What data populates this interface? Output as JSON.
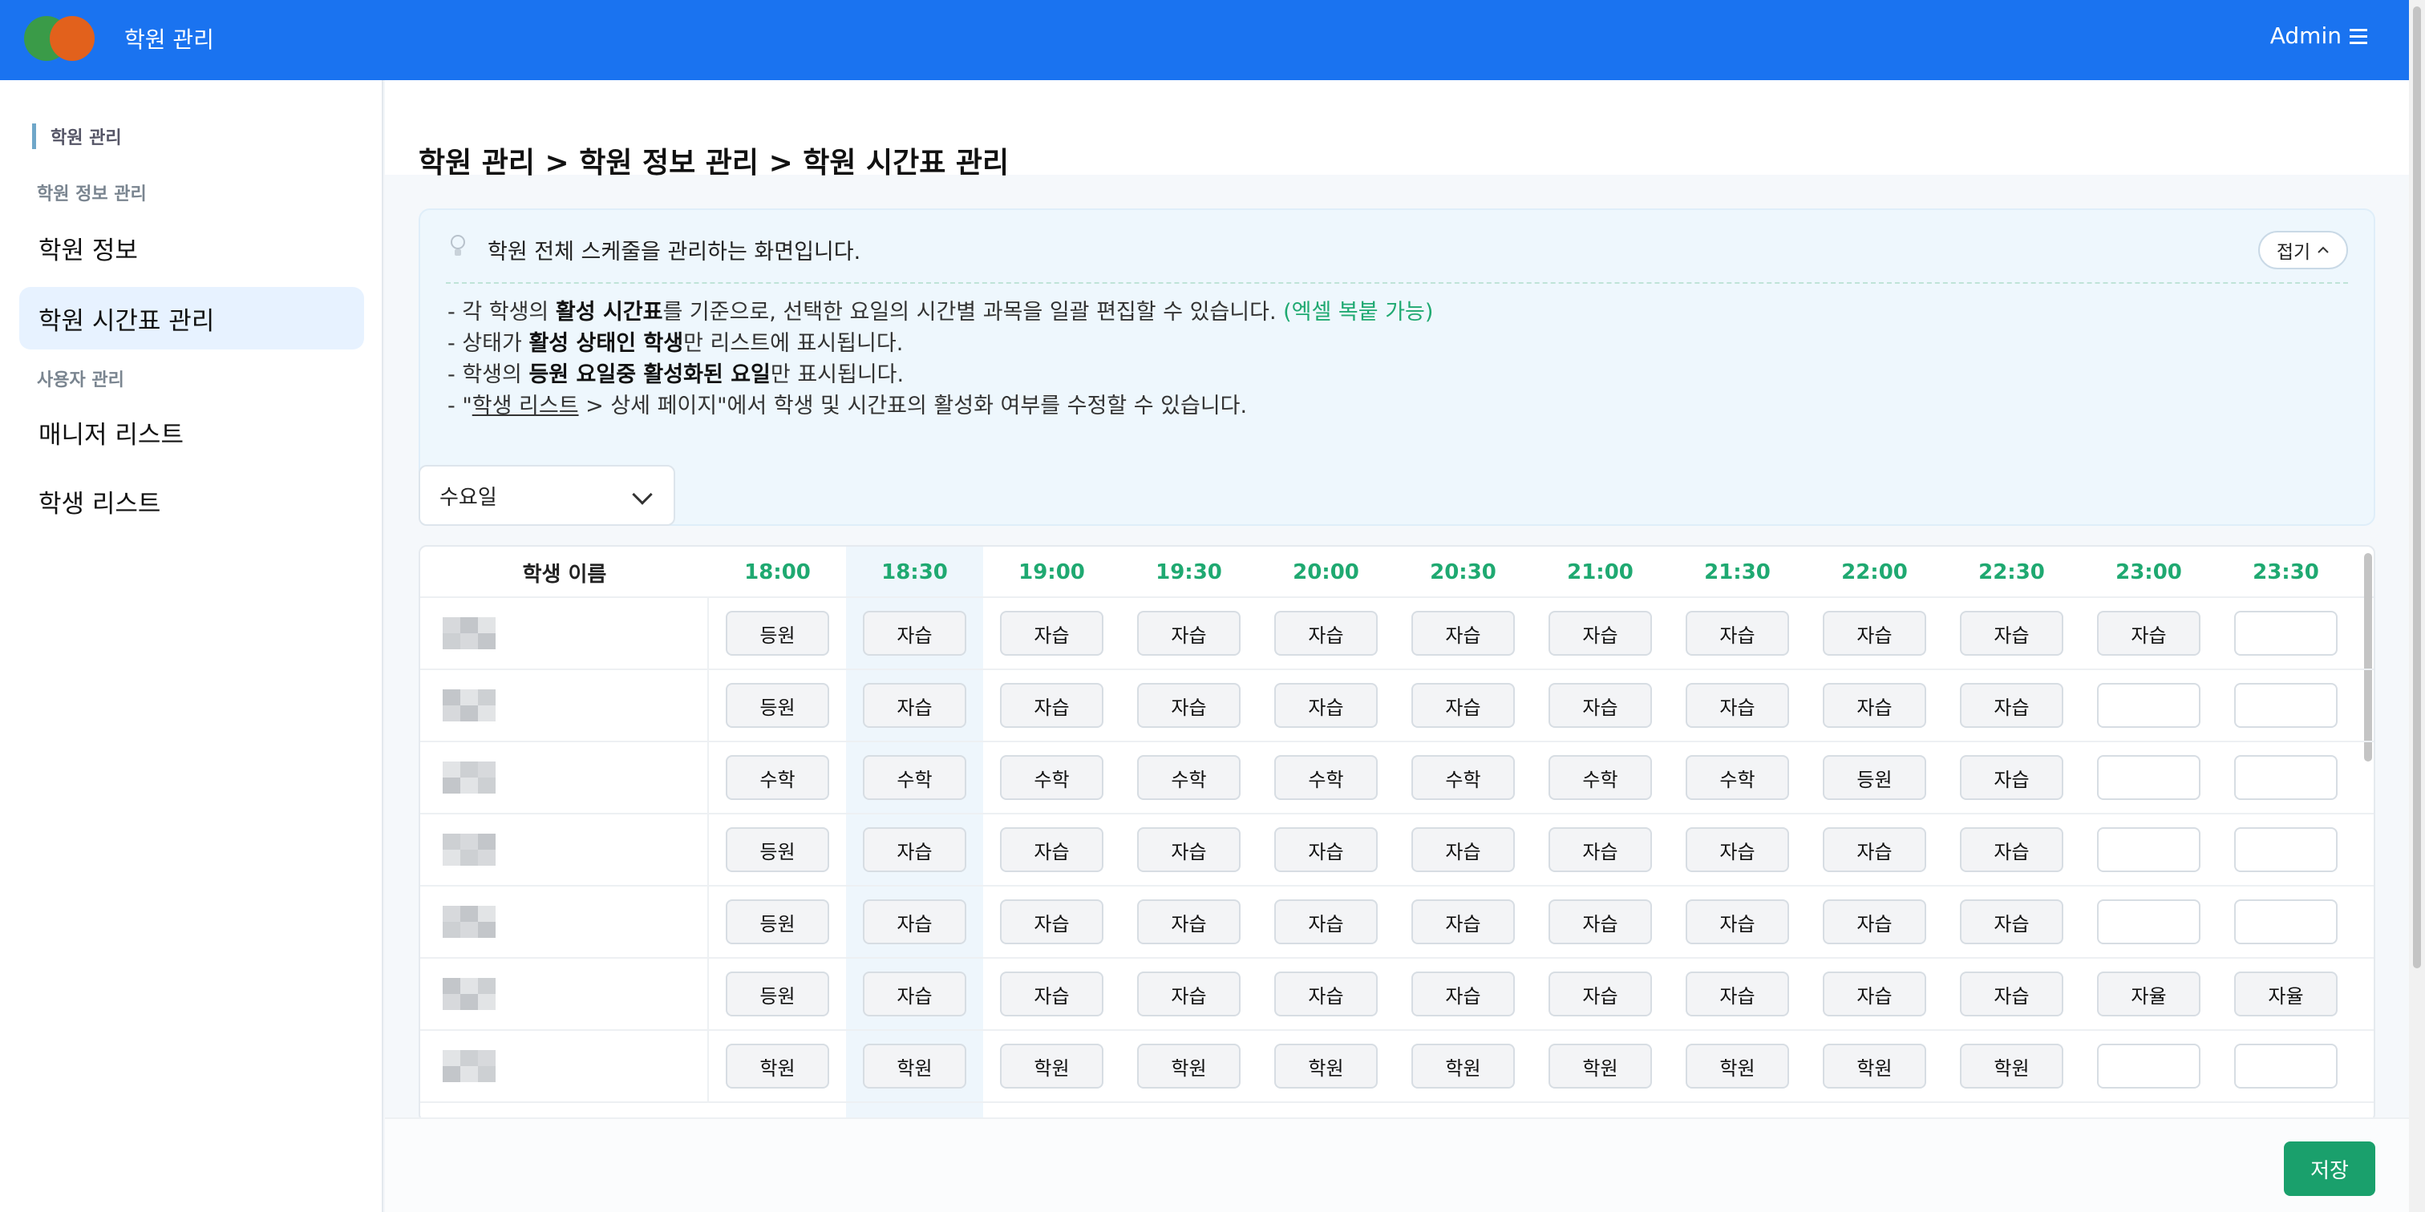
{
  "app": {
    "title": "학원 관리",
    "user": "Admin"
  },
  "sidebar": {
    "root": "학원 관리",
    "sections": [
      {
        "label": "학원 정보 관리",
        "items": [
          {
            "label": "학원 정보",
            "active": false
          },
          {
            "label": "학원 시간표 관리",
            "active": true
          }
        ]
      },
      {
        "label": "사용자 관리",
        "items": [
          {
            "label": "매니저 리스트",
            "active": false
          },
          {
            "label": "학생 리스트",
            "active": false
          }
        ]
      }
    ]
  },
  "breadcrumb": "학원 관리 > 학원 정보 관리 > 학원 시간표 관리",
  "info": {
    "heading": "학원 전체 스케줄을 관리하는 화면입니다.",
    "collapse_label": "접기",
    "line1": {
      "pre": "- 각 학생의 ",
      "bold": "활성 시간표",
      "mid": "를 기준으로, 선택한 요일의 시간별 과목을 일괄 편집할 수 있습니다. ",
      "green": "(엑셀 복붙 가능)"
    },
    "line2": {
      "pre": "- 상태가 ",
      "bold": "활성 상태인 학생",
      "post": "만 리스트에 표시됩니다."
    },
    "line3": {
      "pre": "- 학생의 ",
      "bold": "등원 요일중 활성화된 요일",
      "post": "만 표시됩니다."
    },
    "line4": {
      "pre": "- \"",
      "link": "학생 리스트",
      "post": " > 상세 페이지\"에서 학생 및 시간표의 활성화 여부를 수정할 수 있습니다."
    }
  },
  "day_select": {
    "value": "수요일"
  },
  "table": {
    "name_header": "학생 이름",
    "times": [
      "18:00",
      "18:30",
      "19:00",
      "19:30",
      "20:00",
      "20:30",
      "21:00",
      "21:30",
      "22:00",
      "22:30",
      "23:00",
      "23:30"
    ],
    "rows": [
      [
        "등원",
        "자습",
        "자습",
        "자습",
        "자습",
        "자습",
        "자습",
        "자습",
        "자습",
        "자습",
        "자습",
        ""
      ],
      [
        "등원",
        "자습",
        "자습",
        "자습",
        "자습",
        "자습",
        "자습",
        "자습",
        "자습",
        "자습",
        "",
        ""
      ],
      [
        "수학",
        "수학",
        "수학",
        "수학",
        "수학",
        "수학",
        "수학",
        "수학",
        "등원",
        "자습",
        "",
        ""
      ],
      [
        "등원",
        "자습",
        "자습",
        "자습",
        "자습",
        "자습",
        "자습",
        "자습",
        "자습",
        "자습",
        "",
        ""
      ],
      [
        "등원",
        "자습",
        "자습",
        "자습",
        "자습",
        "자습",
        "자습",
        "자습",
        "자습",
        "자습",
        "",
        ""
      ],
      [
        "등원",
        "자습",
        "자습",
        "자습",
        "자습",
        "자습",
        "자습",
        "자습",
        "자습",
        "자습",
        "자율",
        "자율"
      ],
      [
        "학원",
        "학원",
        "학원",
        "학원",
        "학원",
        "학원",
        "학원",
        "학원",
        "학원",
        "학원",
        "",
        ""
      ]
    ]
  },
  "save_label": "저장",
  "colors": {
    "topbar": "#1a73f0",
    "time_header": "#1fa971",
    "save": "#1aa06c",
    "active_nav": "#e7f2ff"
  }
}
